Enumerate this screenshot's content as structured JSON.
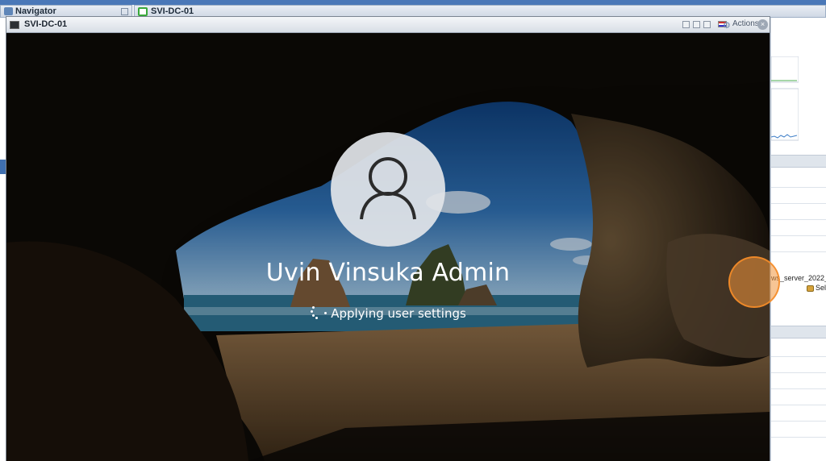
{
  "client": {
    "navigator_title": "Navigator",
    "tab_title": "SVI-DC-01",
    "right_panel": {
      "row_text": "ws_server_2022_",
      "row_sel": "Sel"
    }
  },
  "console": {
    "title": "SVI-DC-01",
    "actions_label": "Actions",
    "close_glyph": "×",
    "gear_glyph": "⚙"
  },
  "lock_screen": {
    "user_name": "Uvin Vinsuka Admin",
    "status_text": "Applying user settings"
  },
  "colors": {
    "accent": "#4a78b8",
    "cursor_highlight": "#f0963c"
  }
}
